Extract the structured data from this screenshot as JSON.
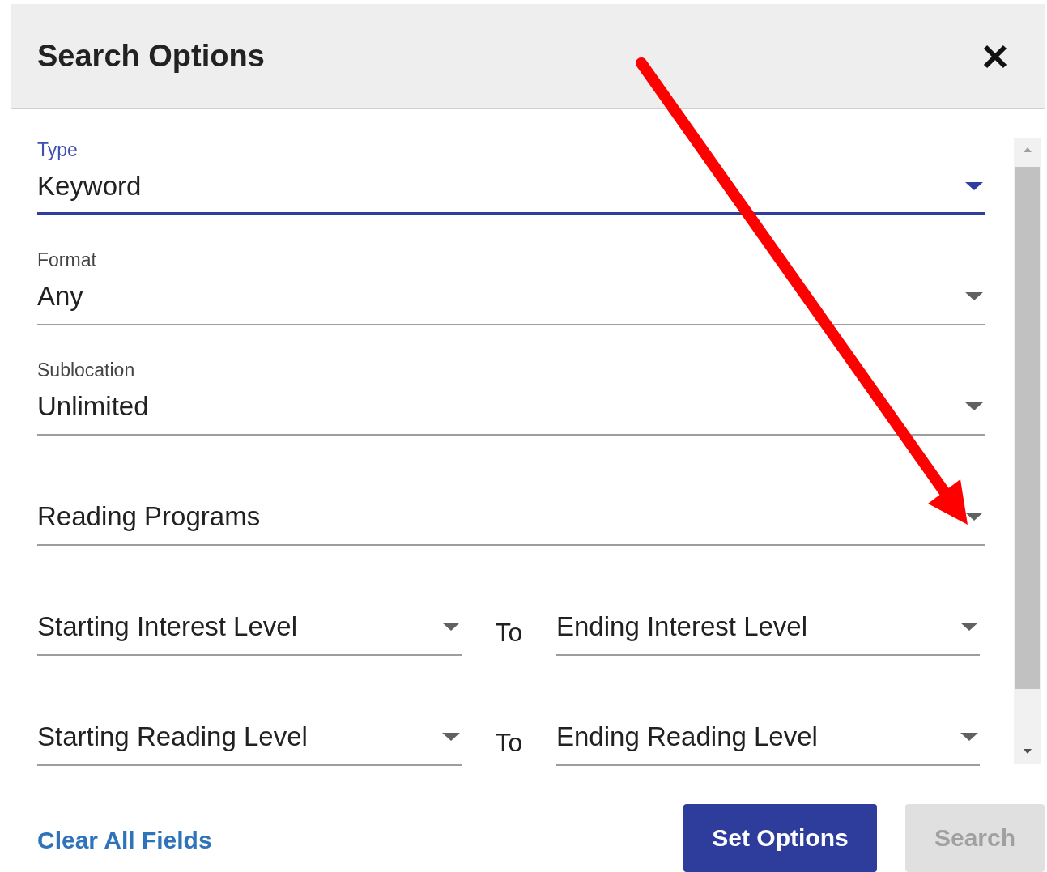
{
  "dialog": {
    "title": "Search Options"
  },
  "fields": [
    {
      "kind": "select",
      "label": "Type",
      "value": "Keyword",
      "focused": true
    },
    {
      "kind": "select",
      "label": "Format",
      "value": "Any",
      "focused": false
    },
    {
      "kind": "select",
      "label": "Sublocation",
      "value": "Unlimited",
      "focused": false
    },
    {
      "kind": "select",
      "value": "Reading Programs",
      "focused": false
    },
    {
      "kind": "range",
      "from": "Starting Interest Level",
      "separator": "To",
      "to": "Ending Interest Level"
    },
    {
      "kind": "range",
      "from": "Starting Reading Level",
      "separator": "To",
      "to": "Ending Reading Level"
    }
  ],
  "footer": {
    "clear_link": "Clear All Fields",
    "buttons": [
      {
        "label": "Set Options",
        "disabled": false
      },
      {
        "label": "Search",
        "disabled": true
      }
    ]
  }
}
